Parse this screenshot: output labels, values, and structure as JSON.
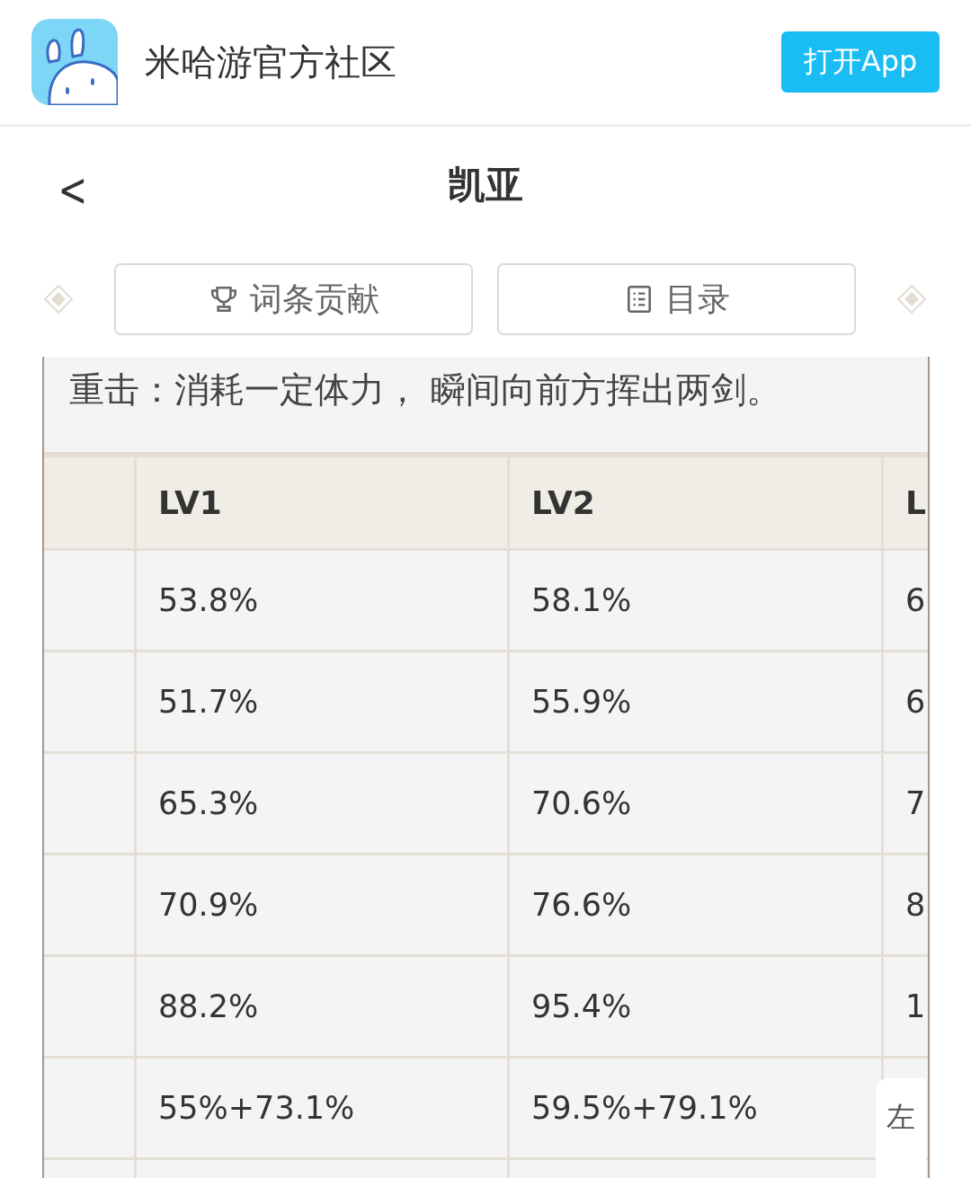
{
  "app_bar": {
    "title": "米哈游官方社区",
    "open_button": "打开App"
  },
  "nav": {
    "back": "<",
    "title": "凯亚"
  },
  "actions": [
    {
      "kind": "trophy",
      "label": "词条贡献"
    },
    {
      "kind": "list",
      "label": "目录"
    }
  ],
  "description": "重击：消耗一定体力， 瞬间向前方挥出两剑。",
  "table": {
    "columns": [
      "LV1",
      "LV2",
      "L"
    ],
    "rows": [
      {
        "cells": [
          "53.8%",
          "58.1%",
          "6"
        ]
      },
      {
        "cells": [
          "51.7%",
          "55.9%",
          "6"
        ]
      },
      {
        "cells": [
          "65.3%",
          "70.6%",
          "7"
        ]
      },
      {
        "cells": [
          "70.9%",
          "76.6%",
          "8"
        ]
      },
      {
        "cells": [
          "88.2%",
          "95.4%",
          "1"
        ]
      },
      {
        "cells": [
          "55%+73.1%",
          "59.5%+79.1%"
        ]
      }
    ]
  },
  "swipe_hint": "左"
}
